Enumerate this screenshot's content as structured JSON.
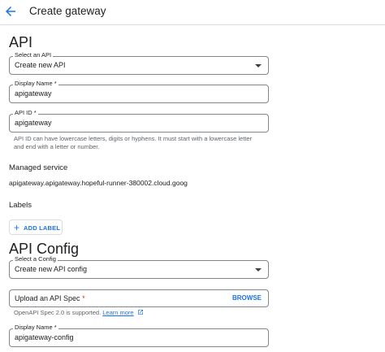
{
  "header": {
    "title": "Create gateway"
  },
  "api_section": {
    "title": "API",
    "select_api": {
      "label": "Select an API",
      "value": "Create new API"
    },
    "display_name": {
      "label": "Display Name *",
      "value": "apigateway"
    },
    "api_id": {
      "label": "API ID *",
      "value": "apigateway",
      "helper_line1": "API ID can have lowercase letters, digits or hyphens. It must start with a lowercase letter",
      "helper_line2": "and end with a letter or number."
    },
    "managed_service": {
      "label": "Managed service",
      "value": "apigateway.apigateway.hopeful-runner-380002.cloud.goog"
    },
    "labels": {
      "label": "Labels",
      "add_button": "ADD LABEL"
    }
  },
  "config_section": {
    "title": "API Config",
    "select_config": {
      "label": "Select a Config",
      "value": "Create new API config"
    },
    "upload_spec": {
      "label": "Upload an API Spec",
      "required_mark": "*",
      "browse_label": "BROWSE",
      "helper_text": "OpenAPI Spec 2.0 is supported.",
      "learn_more": "Learn more"
    },
    "display_name": {
      "label": "Display Name *",
      "value": "apigateway-config"
    }
  },
  "colors": {
    "accent": "#1a73e8",
    "required": "#d93025",
    "border": "#80868b"
  }
}
